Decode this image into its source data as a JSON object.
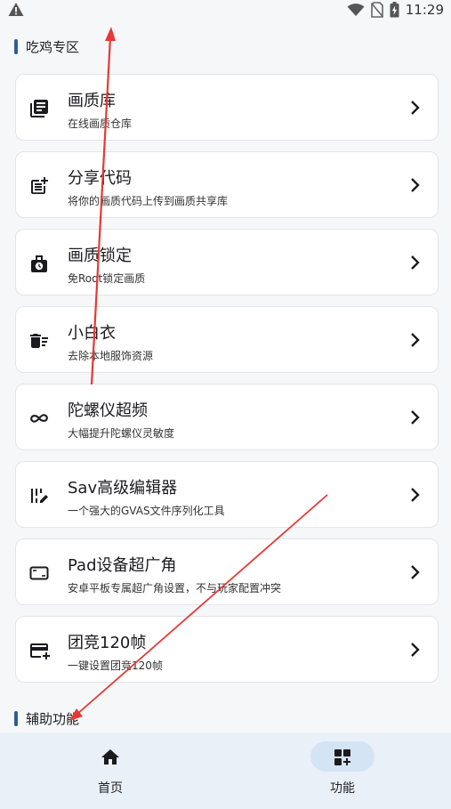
{
  "status_bar": {
    "time": "11:29"
  },
  "sections": [
    {
      "title": "吃鸡专区"
    },
    {
      "title": "辅助功能"
    }
  ],
  "cards": [
    {
      "title": "画质库",
      "subtitle": "在线画质仓库",
      "icon": "library-icon"
    },
    {
      "title": "分享代码",
      "subtitle": "将你的画质代码上传到画质共享库",
      "icon": "post-add-icon"
    },
    {
      "title": "画质锁定",
      "subtitle": "免Root锁定画质",
      "icon": "lock-clock-icon"
    },
    {
      "title": "小白衣",
      "subtitle": "去除本地服饰资源",
      "icon": "delete-sweep-icon"
    },
    {
      "title": "陀螺仪超频",
      "subtitle": "大幅提升陀螺仪灵敏度",
      "icon": "infinity-icon"
    },
    {
      "title": "Sav高级编辑器",
      "subtitle": "一个强大的GVAS文件序列化工具",
      "icon": "edit-list-icon"
    },
    {
      "title": "Pad设备超广角",
      "subtitle": "安卓平板专属超广角设置，不与玩家配置冲突",
      "icon": "aspect-ratio-icon"
    },
    {
      "title": "团竞120帧",
      "subtitle": "一键设置团竞120帧",
      "icon": "add-card-icon"
    }
  ],
  "bottom_nav": [
    {
      "label": "首页",
      "icon": "home-icon",
      "active": false
    },
    {
      "label": "功能",
      "icon": "dashboard-add-icon",
      "active": true
    }
  ],
  "colors": {
    "accent": "#2b5f95",
    "annotation_arrow": "#e53935",
    "nav_bg": "#eaf0f7",
    "nav_pill": "#d5e4f5"
  }
}
